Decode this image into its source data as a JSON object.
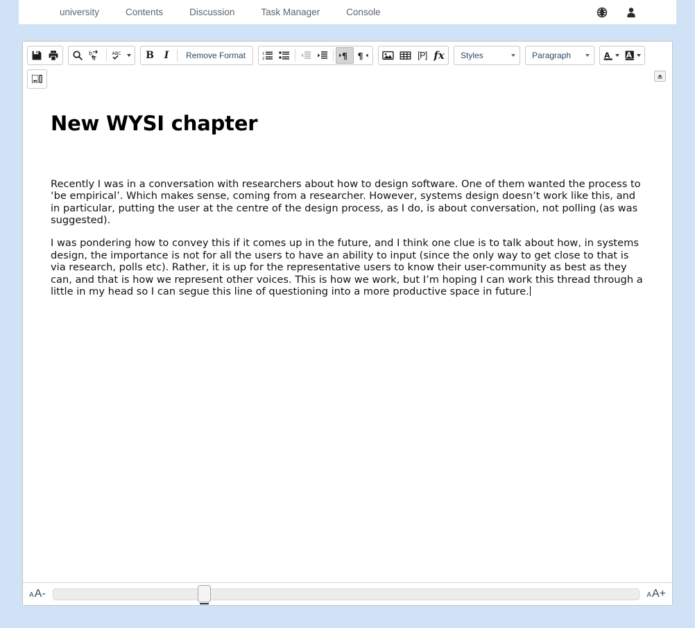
{
  "header": {
    "nav_items": [
      {
        "label": "university",
        "name": "nav-university"
      },
      {
        "label": "Contents",
        "name": "nav-contents"
      },
      {
        "label": "Discussion",
        "name": "nav-discussion"
      },
      {
        "label": "Task Manager",
        "name": "nav-task-manager"
      },
      {
        "label": "Console",
        "name": "nav-console"
      }
    ],
    "icons": [
      {
        "name": "globe-icon",
        "title": "Language"
      },
      {
        "name": "user-icon",
        "title": "Account"
      }
    ]
  },
  "toolbar": {
    "save_title": "Save",
    "print_title": "Print",
    "find_title": "Find",
    "replace_title": "Replace",
    "spellcheck_title": "Spell Check As You Type",
    "bold_label": "B",
    "bold_title": "Bold",
    "italic_label": "I",
    "italic_title": "Italic",
    "remove_format_label": "Remove Format",
    "numbered_list_title": "Insert/Remove Numbered List",
    "bulleted_list_title": "Insert/Remove Bulleted List",
    "outdent_title": "Decrease Indent",
    "indent_title": "Increase Indent",
    "ltr_title": "Text direction from left to right",
    "rtl_title": "Text direction from right to left",
    "image_title": "Image",
    "table_title": "Table",
    "placeholder_label": "[P]",
    "placeholder_title": "Create Placeholder",
    "math_label": "fx",
    "math_title": "Mathematical Formula",
    "styles_label": "Styles",
    "paragraph_label": "Paragraph",
    "text_color_label": "A",
    "text_color_title": "Text Color",
    "bg_color_label": "A",
    "bg_color_title": "Background Color",
    "show_blocks_title": "Show Blocks",
    "collapse_title": "Collapse Toolbar",
    "accent_color": "#2d4a66",
    "active_button_color": "#d4d4d4"
  },
  "document": {
    "title": "New WYSI chapter",
    "paragraphs": [
      "Recently I was in a conversation with researchers about how to design software. One of them wanted the process to ‘be empirical’. Which makes sense, coming from a researcher. However, systems design doesn’t work like this, and in particular, putting the user at the centre of the design process, as I do, is about conversation, not polling (as was suggested).",
      "I was pondering how to convey this if it comes up in the future, and I think one clue is to talk about how, in systems design, the importance is not for all the users to have an ability to input (since the only way to get close to that is via research, polls etc). Rather, it is up for the representative users to know their user-community as best as they can, and that is how we represent other voices. This is how we work, but I’m hoping I can work this thread through a little in my head so I can segue this line of questioning into a more productive space in future."
    ]
  },
  "bottombar": {
    "decrease_small": "A",
    "decrease_large": "A-",
    "decrease_title": "Decrease font size",
    "increase_small": "A",
    "increase_large": "A+",
    "increase_title": "Increase font size",
    "slider_value": 22
  },
  "colors": {
    "page_background": "#cfe2f6",
    "header_background": "#ffffff",
    "editor_border": "#c3c3c3",
    "nav_text": "#5a6672"
  }
}
